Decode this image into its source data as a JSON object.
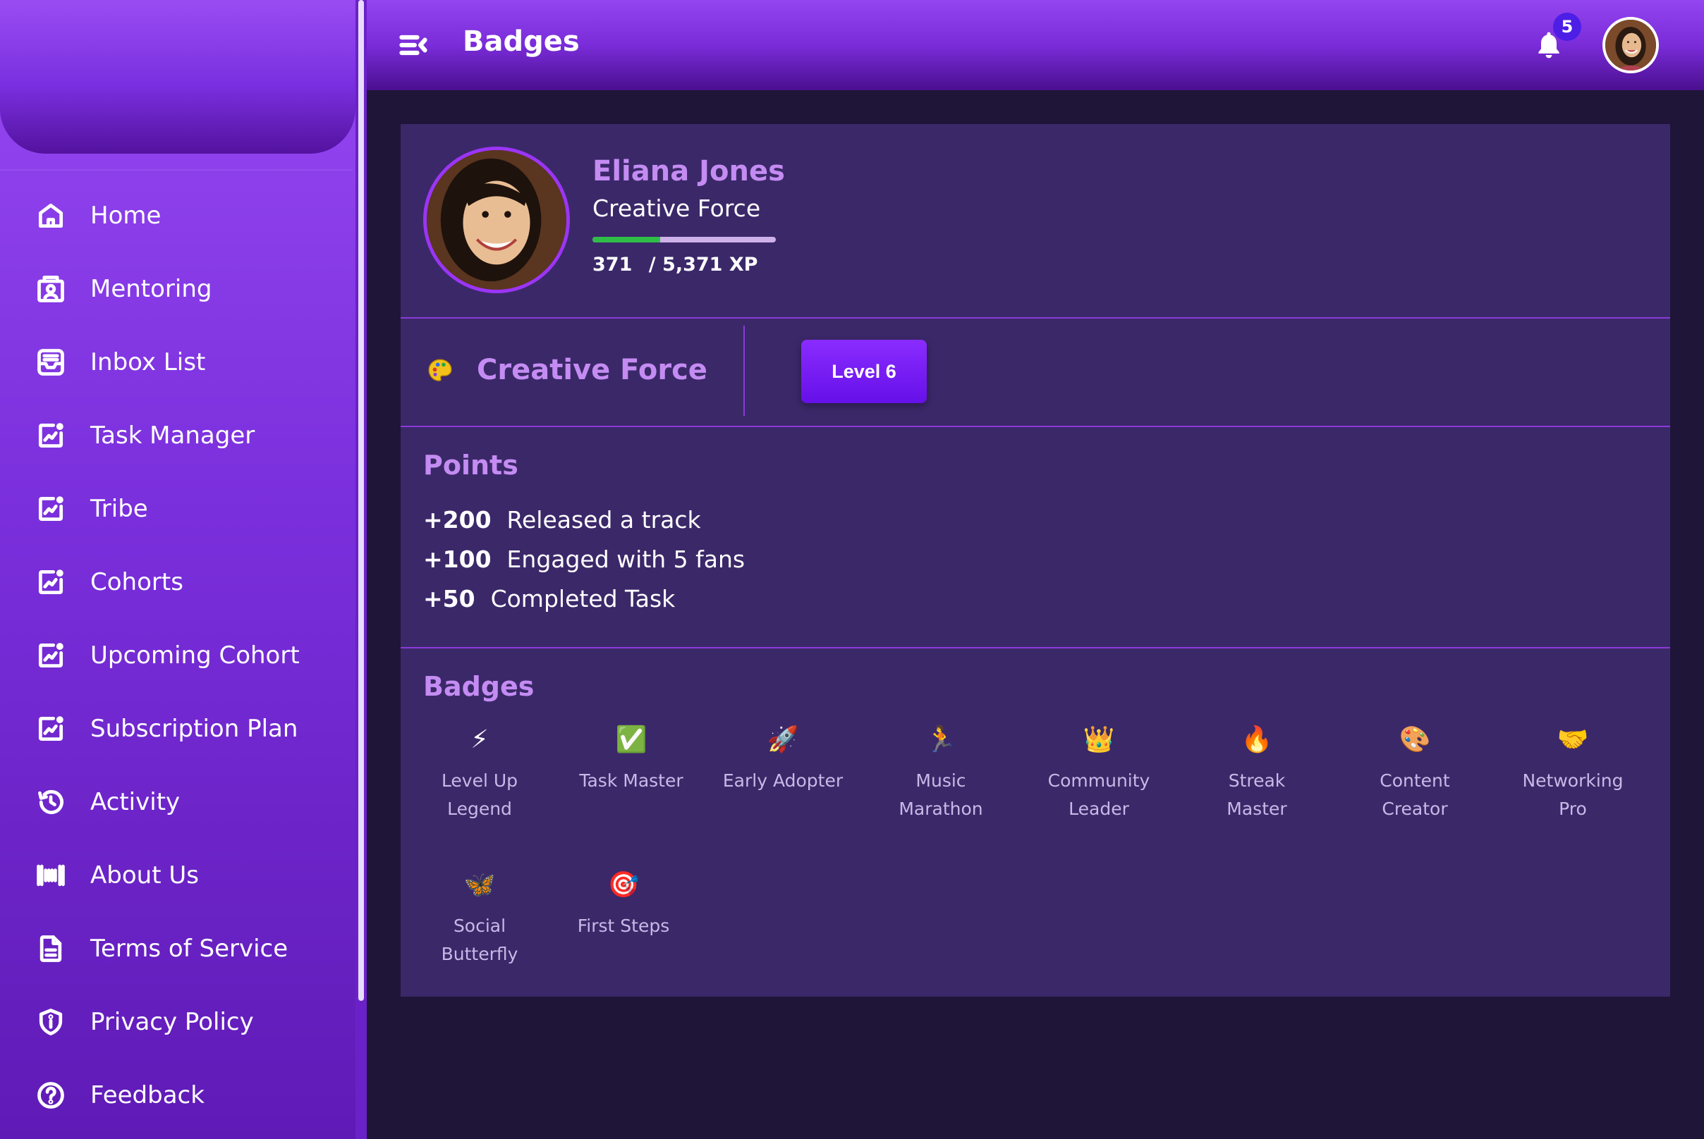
{
  "header": {
    "title": "Badges",
    "notification_count": "5"
  },
  "sidebar": {
    "items": [
      {
        "label": "Home",
        "icon": "home-icon"
      },
      {
        "label": "Mentoring",
        "icon": "mentoring-icon"
      },
      {
        "label": "Inbox List",
        "icon": "inbox-icon"
      },
      {
        "label": "Task Manager",
        "icon": "chart-icon"
      },
      {
        "label": "Tribe",
        "icon": "chart-icon"
      },
      {
        "label": "Cohorts",
        "icon": "chart-icon"
      },
      {
        "label": "Upcoming Cohort",
        "icon": "chart-icon"
      },
      {
        "label": "Subscription Plan",
        "icon": "chart-icon"
      },
      {
        "label": "Activity",
        "icon": "history-icon"
      },
      {
        "label": "About Us",
        "icon": "barcode-icon"
      },
      {
        "label": "Terms of Service",
        "icon": "document-icon"
      },
      {
        "label": "Privacy Policy",
        "icon": "shield-icon"
      },
      {
        "label": "Feedback",
        "icon": "help-icon"
      }
    ]
  },
  "profile": {
    "name": "Eliana Jones",
    "role": "Creative Force",
    "xp_current": "371",
    "xp_total": "/ 5,371 XP",
    "xp_progress": 0.37
  },
  "level": {
    "icon": "🎨",
    "title": "Creative Force",
    "button_label": "Level 6"
  },
  "points": {
    "title": "Points",
    "items": [
      {
        "value": "+200",
        "label": "Released a track"
      },
      {
        "value": "+100",
        "label": "Engaged with 5 fans"
      },
      {
        "value": "+50",
        "label": "Completed Task"
      }
    ]
  },
  "badges": {
    "title": "Badges",
    "items": [
      {
        "icon": "⚡",
        "line1": "Level Up",
        "line2": "Legend"
      },
      {
        "icon": "✅",
        "line1": "Task Master",
        "line2": ""
      },
      {
        "icon": "🚀",
        "line1": "Early Adopter",
        "line2": ""
      },
      {
        "icon": "🏃",
        "line1": "Music",
        "line2": "Marathon"
      },
      {
        "icon": "👑",
        "line1": "Community",
        "line2": "Leader"
      },
      {
        "icon": "🔥",
        "line1": "Streak",
        "line2": "Master"
      },
      {
        "icon": "🎨",
        "line1": "Content",
        "line2": "Creator"
      },
      {
        "icon": "🤝",
        "line1": "Networking",
        "line2": "Pro"
      },
      {
        "icon": "🦋",
        "line1": "Social",
        "line2": "Butterfly"
      },
      {
        "icon": "🎯",
        "line1": "First Steps",
        "line2": ""
      }
    ]
  },
  "colors": {
    "accent": "#c48cf2",
    "card": "#3b2869",
    "background": "#1e1538",
    "progress": "#2fbe48"
  }
}
